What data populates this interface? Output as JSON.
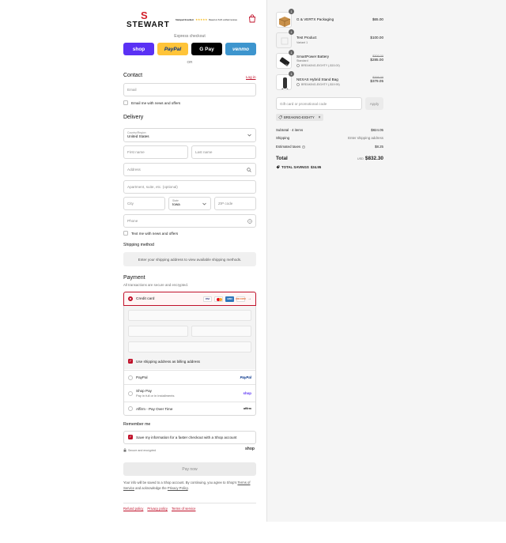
{
  "header": {
    "logo_mark": "S",
    "logo_text": "STEWART",
    "reviews_label": "Stamped Excellent",
    "reviews_count": "Based on 8.2K verified reviews",
    "stars": "★★★★★"
  },
  "express": {
    "label": "Express checkout",
    "buttons": [
      "shop",
      "PayPal",
      "G Pay",
      "venmo"
    ],
    "or": "OR"
  },
  "contact": {
    "title": "Contact",
    "login": "Log in",
    "email_placeholder": "Email",
    "news_label": "Email me with news and offers"
  },
  "delivery": {
    "title": "Delivery",
    "country_label": "Country/Region",
    "country_value": "United States",
    "first_name": "First name",
    "last_name": "Last name",
    "address": "Address",
    "apartment": "Apartment, suite, etc. (optional)",
    "city": "City",
    "state_label": "State",
    "state_value": "Iowa",
    "zip": "ZIP code",
    "phone": "Phone",
    "text_label": "Text me with news and offers"
  },
  "shipping": {
    "title": "Shipping method",
    "note": "Enter your shipping address to view available shipping methods."
  },
  "payment": {
    "title": "Payment",
    "subtitle": "All transactions are secure and encrypted.",
    "credit_card": "Credit card",
    "card_brands": [
      "VISA",
      "mastercard",
      "AMEX",
      "DISCOVER"
    ],
    "more": "→",
    "billing_label": "Use shipping address as billing address",
    "options": [
      {
        "label": "PayPal",
        "sub": "",
        "brand": "PayPal",
        "brand_color": "#003087"
      },
      {
        "label": "Shop Pay",
        "sub": "Pay in full or in installments",
        "brand": "shop",
        "brand_color": "#5a31f4"
      },
      {
        "label": "Affirm - Pay Over Time",
        "sub": "",
        "brand": "affirm",
        "brand_color": "#111111"
      }
    ]
  },
  "remember": {
    "title": "Remember me",
    "save_label": "Save my information for a faster checkout with a Shop account",
    "secure": "Secure and encrypted",
    "shop_brand": "shop"
  },
  "pay_now": "Pay now",
  "legal": {
    "part1": "Your info will be saved to a Shop account. By continuing, you agree to Shop's",
    "terms": "Terms of Service",
    "part2": "and acknowledge the",
    "privacy": "Privacy Policy",
    "end": "."
  },
  "footer": {
    "links": [
      "Refund policy",
      "Privacy policy",
      "Terms of service"
    ]
  },
  "summary": {
    "items": [
      {
        "qty": "1",
        "name": "G & VERTX Packaging",
        "sub": "",
        "discount": "",
        "old_price": "",
        "price": "$65.00"
      },
      {
        "qty": "1",
        "name": "Test Product",
        "sub": "Variant 1",
        "discount": "",
        "old_price": "",
        "price": "$100.00"
      },
      {
        "qty": "1",
        "name": "SmartPower Battery",
        "sub": "Standard",
        "discount": "BREAKING-EIGHTY (-$15.00)",
        "old_price": "$300.00",
        "price": "$285.00"
      },
      {
        "qty": "1",
        "name": "NEXAS Hybrid Stand Bag",
        "sub": "",
        "discount": "BREAKING-EIGHTY (-$19.95)",
        "old_price": "$399.00",
        "price": "$379.05"
      }
    ],
    "gift_placeholder": "Gift card or promotional code",
    "apply": "Apply",
    "tag": "BREAKING-EIGHTY",
    "subtotal_label": "Subtotal · 4 items",
    "subtotal_value": "$824.05",
    "shipping_label": "Shipping",
    "shipping_value": "Enter shipping address",
    "taxes_label": "Estimated taxes",
    "taxes_value": "$8.25",
    "total_label": "Total",
    "currency": "USD",
    "total_value": "$832.30",
    "savings_label": "TOTAL SAVINGS",
    "savings_value": "$34.95"
  }
}
